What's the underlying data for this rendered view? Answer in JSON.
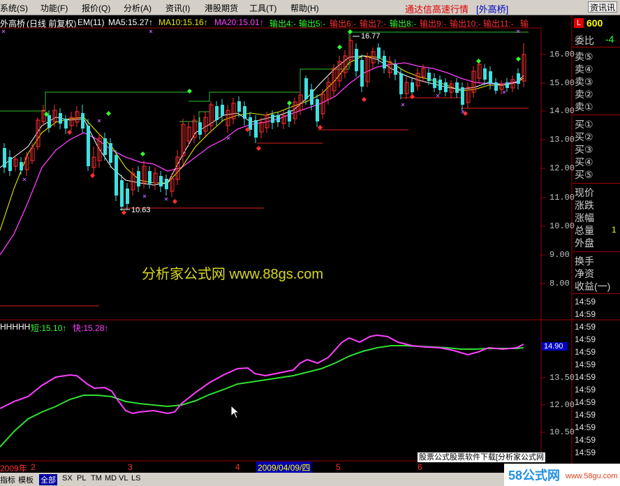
{
  "menu": {
    "items": [
      "系统(S)",
      "功能(F)",
      "报价(Q)",
      "分析(A)",
      "资讯(I)",
      "港股期货",
      "工具(T)",
      "帮助(H)"
    ],
    "title": "通达信高速行情",
    "title_tag": "[外高桥]",
    "right_button": "资讯讯"
  },
  "chart_header": {
    "name": "外高桥",
    "mode": "(日线 前复权)",
    "em": "EM(11)",
    "ma5": "MA5:15.27↑",
    "ma10": "MA10:15.16↑",
    "ma20": "MA20:15.01↑",
    "out4": "输出4:-",
    "out5": "输出5:-",
    "out6": "输出6:-",
    "out7": "输出7:-",
    "out8": "输出8:-",
    "out9": "输出9:-",
    "out10": "输出10:-",
    "out11": "输出11:-",
    "out12": "输"
  },
  "price_axis": [
    "16.00",
    "15.00",
    "14.00",
    "13.00",
    "12.00",
    "11.00",
    "10.00",
    "9.00",
    "8.00"
  ],
  "annotations": {
    "high": "16.77",
    "low": "10.63"
  },
  "watermark": "分析家公式网 www.88gs.com",
  "indicator": {
    "header_name": "HHHHH",
    "short": "短:15.10↑",
    "fast": "快:15.28↑",
    "value_box": "14.90",
    "axis": [
      "13.50",
      "12.00",
      "10.50"
    ]
  },
  "date_axis": {
    "year": "2009年",
    "m2": "2",
    "m3": "3",
    "m4": "4",
    "selected": "2009/04/09/四",
    "m5": "5",
    "m6": "6"
  },
  "bottom_banner": "股票公式股票软件下载[分析家公式网",
  "tabs": [
    "指标",
    "模板",
    "全部",
    "SX",
    "PL",
    "TM",
    "MD",
    "VL",
    "LS"
  ],
  "right_panel": {
    "code": "600",
    "weibi_label": "委比",
    "weibi_value": "-4",
    "sell": [
      "卖⑤",
      "卖④",
      "卖③",
      "卖②",
      "卖①"
    ],
    "buy": [
      "买①",
      "买②",
      "买③",
      "买④",
      "买⑤"
    ],
    "stats": [
      "现价",
      "涨跌",
      "涨幅",
      "总量",
      "外盘"
    ],
    "stats2": [
      "换手",
      "净资",
      "收益(一)"
    ],
    "times": [
      "14:59",
      "14:59",
      "14:59",
      "14:59",
      "14:59",
      "14:59",
      "14:59",
      "14:59",
      "14:59",
      "14:59",
      "14:59",
      "14:59",
      "14:59",
      "14:59"
    ]
  },
  "watermark2": "58公式网",
  "watermark2_url": "www.58gu.com",
  "colors": {
    "ma5": "#ffffff",
    "ma10": "#e8e800",
    "ma20": "#ff40ff",
    "up": "#ff3030",
    "down": "#40e0e0",
    "short_line": "#30ff30",
    "fast_line": "#ff40ff"
  }
}
